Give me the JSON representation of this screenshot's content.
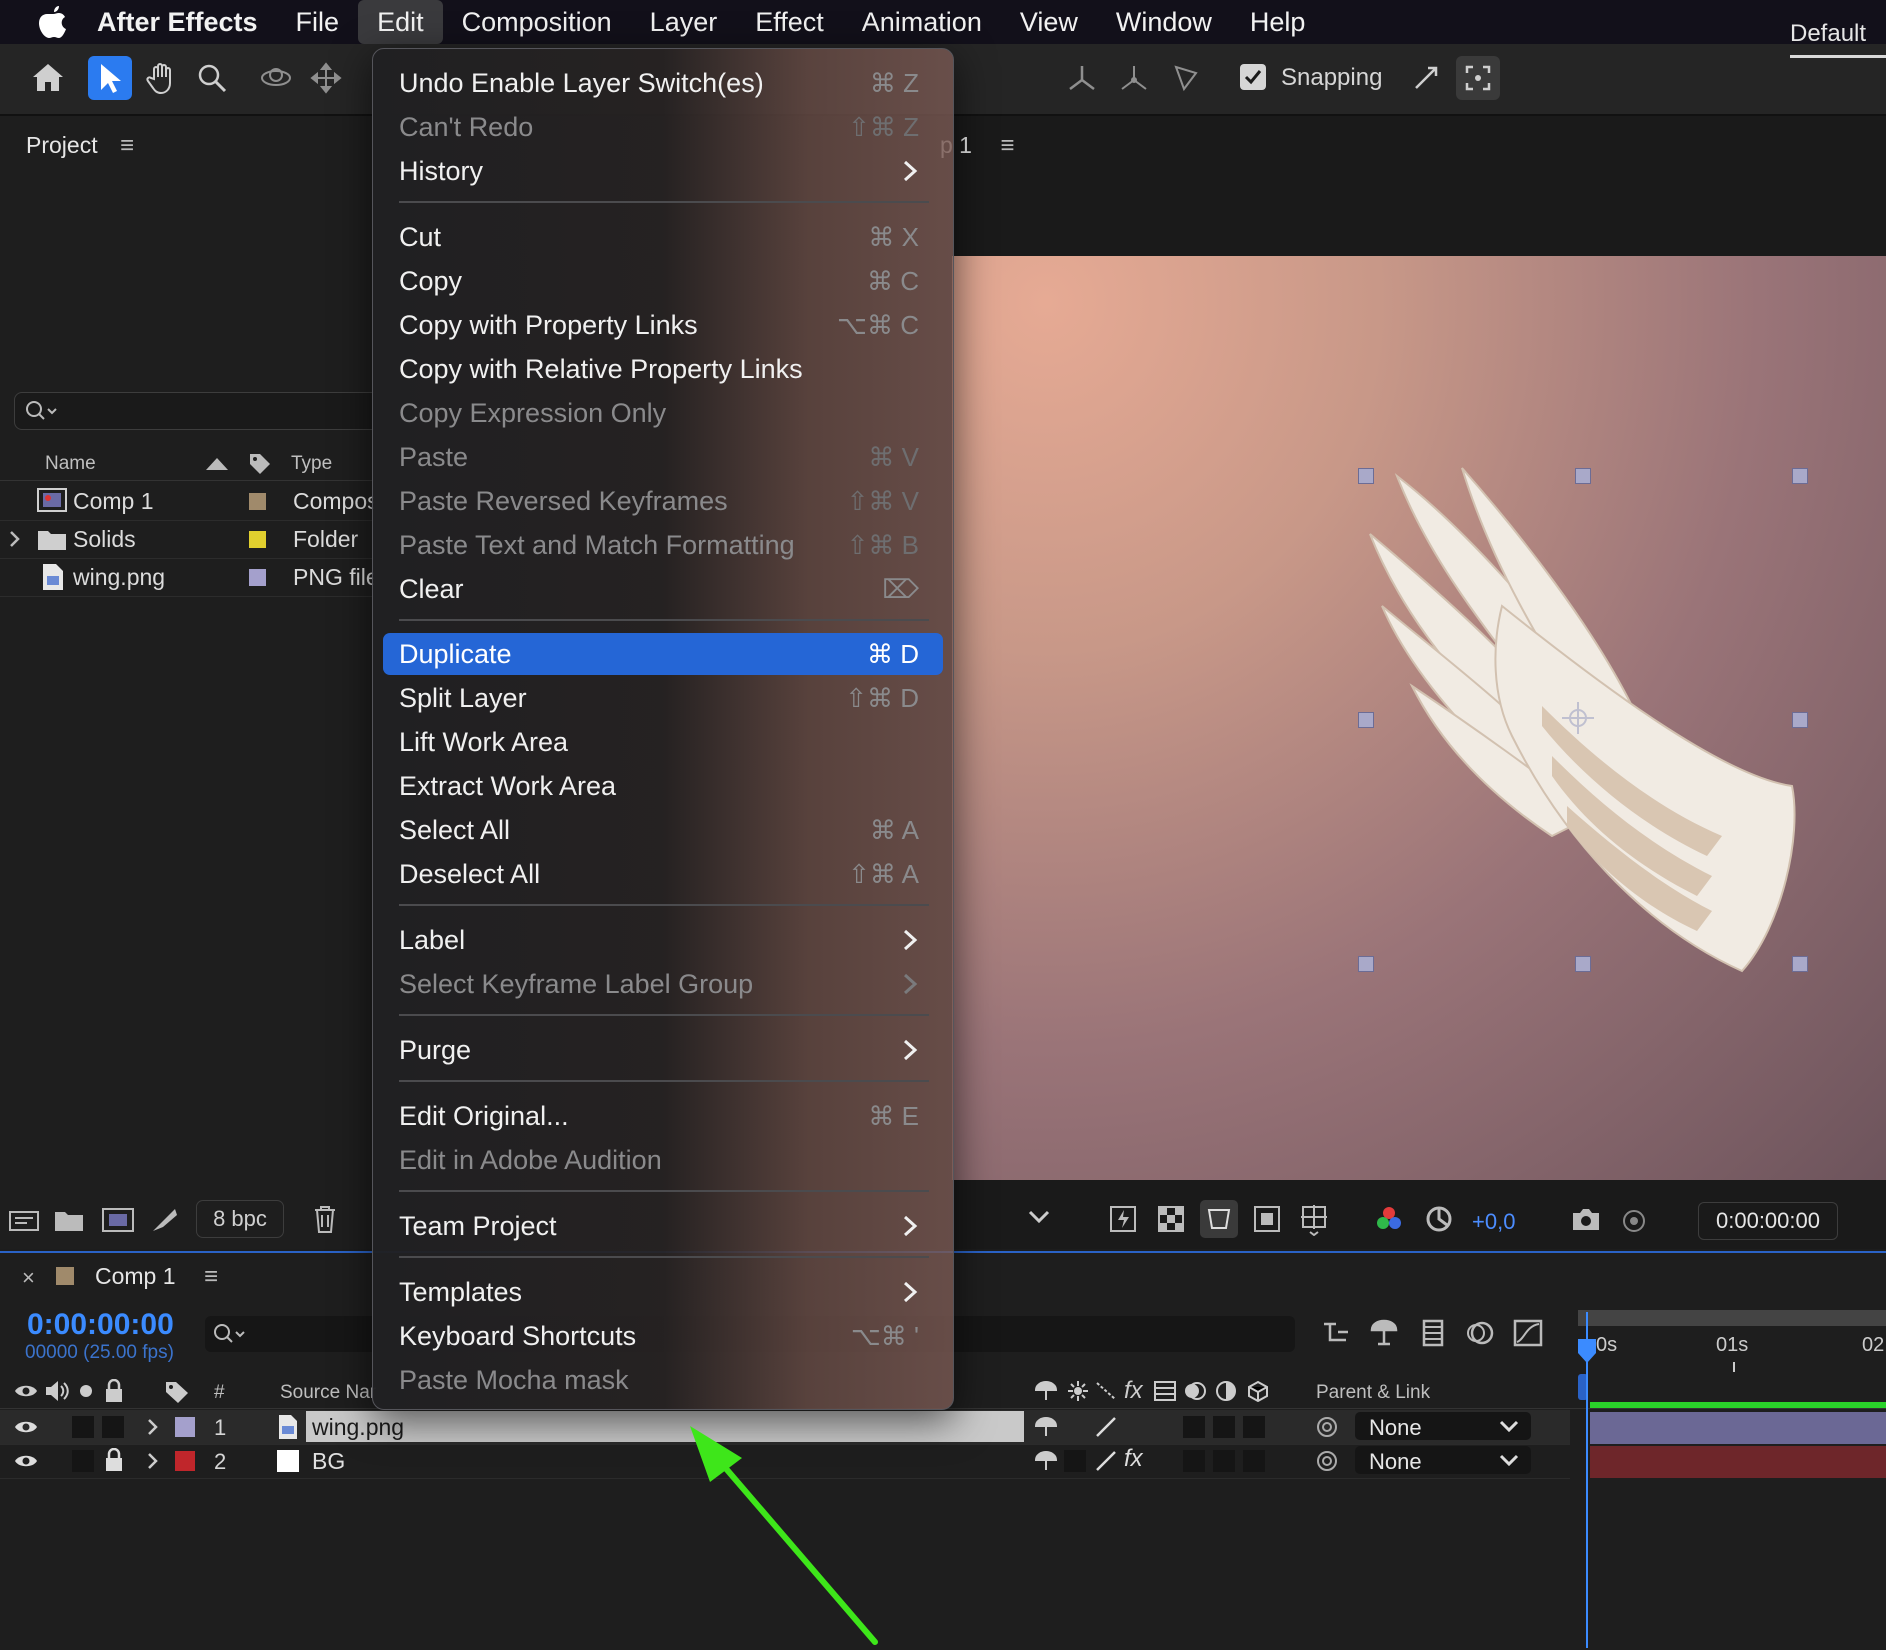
{
  "menubar": {
    "app": "After Effects",
    "items": [
      "File",
      "Edit",
      "Composition",
      "Layer",
      "Effect",
      "Animation",
      "View",
      "Window",
      "Help"
    ]
  },
  "toolbar": {
    "snapping_label": "Snapping",
    "workspace": "Default"
  },
  "project": {
    "title": "Project",
    "columns": {
      "name": "Name",
      "type": "Type"
    },
    "items": [
      {
        "name": "Comp 1",
        "type": "Compos",
        "color": "#a08a6b"
      },
      {
        "name": "Solids",
        "type": "Folder",
        "color": "#e1cf2e"
      },
      {
        "name": "wing.png",
        "type": "PNG file",
        "color": "#a4a0cc"
      }
    ],
    "bpc": "8 bpc"
  },
  "viewer": {
    "tab_title": "p 1",
    "exposure": "+0,0",
    "timecode": "0:00:00:00"
  },
  "edit_menu": {
    "groups": [
      [
        {
          "label": "Undo Enable Layer Switch(es)",
          "shortcut": "⌘ Z",
          "enabled": true
        },
        {
          "label": "Can't Redo",
          "shortcut": "⇧⌘ Z",
          "enabled": false
        },
        {
          "label": "History",
          "submenu": true,
          "enabled": true
        }
      ],
      [
        {
          "label": "Cut",
          "shortcut": "⌘ X",
          "enabled": true
        },
        {
          "label": "Copy",
          "shortcut": "⌘ C",
          "enabled": true
        },
        {
          "label": "Copy with Property Links",
          "shortcut": "⌥⌘ C",
          "enabled": true
        },
        {
          "label": "Copy with Relative Property Links",
          "enabled": true
        },
        {
          "label": "Copy Expression Only",
          "enabled": false
        },
        {
          "label": "Paste",
          "shortcut": "⌘ V",
          "enabled": false
        },
        {
          "label": "Paste Reversed Keyframes",
          "shortcut": "⇧⌘ V",
          "enabled": false
        },
        {
          "label": "Paste Text and Match Formatting",
          "shortcut": "⇧⌘ B",
          "enabled": false
        },
        {
          "label": "Clear",
          "shortcut": "⌦",
          "enabled": true
        }
      ],
      [
        {
          "label": "Duplicate",
          "shortcut": "⌘ D",
          "enabled": true,
          "highlighted": true
        },
        {
          "label": "Split Layer",
          "shortcut": "⇧⌘ D",
          "enabled": true
        },
        {
          "label": "Lift Work Area",
          "enabled": true
        },
        {
          "label": "Extract Work Area",
          "enabled": true
        },
        {
          "label": "Select All",
          "shortcut": "⌘ A",
          "enabled": true
        },
        {
          "label": "Deselect All",
          "shortcut": "⇧⌘ A",
          "enabled": true
        }
      ],
      [
        {
          "label": "Label",
          "submenu": true,
          "enabled": true
        },
        {
          "label": "Select Keyframe Label Group",
          "submenu": true,
          "enabled": false
        }
      ],
      [
        {
          "label": "Purge",
          "submenu": true,
          "enabled": true
        }
      ],
      [
        {
          "label": "Edit Original...",
          "shortcut": "⌘ E",
          "enabled": true
        },
        {
          "label": "Edit in Adobe Audition",
          "enabled": false
        }
      ],
      [
        {
          "label": "Team Project",
          "submenu": true,
          "enabled": true
        }
      ],
      [
        {
          "label": "Templates",
          "submenu": true,
          "enabled": true
        },
        {
          "label": "Keyboard Shortcuts",
          "shortcut": "⌥⌘ '",
          "enabled": true
        },
        {
          "label": "Paste Mocha mask",
          "enabled": false
        }
      ]
    ]
  },
  "timeline": {
    "comp_name": "Comp 1",
    "timecode": "0:00:00:00",
    "fps": "00000 (25.00 fps)",
    "columns": {
      "number": "#",
      "source": "Source Nar",
      "parent": "Parent & Link"
    },
    "ruler": [
      "0s",
      "01s",
      "02"
    ],
    "layers": [
      {
        "number": "1",
        "source": "wing.png",
        "parent": "None",
        "color": "#a4a0cc",
        "selected": true
      },
      {
        "number": "2",
        "source": "BG",
        "parent": "None",
        "color": "#c0262b",
        "selected": false
      }
    ]
  },
  "colors": {
    "accent": "#2566d6",
    "timecode_blue": "#3b8bff",
    "annotation_arrow": "#3ee61a"
  }
}
